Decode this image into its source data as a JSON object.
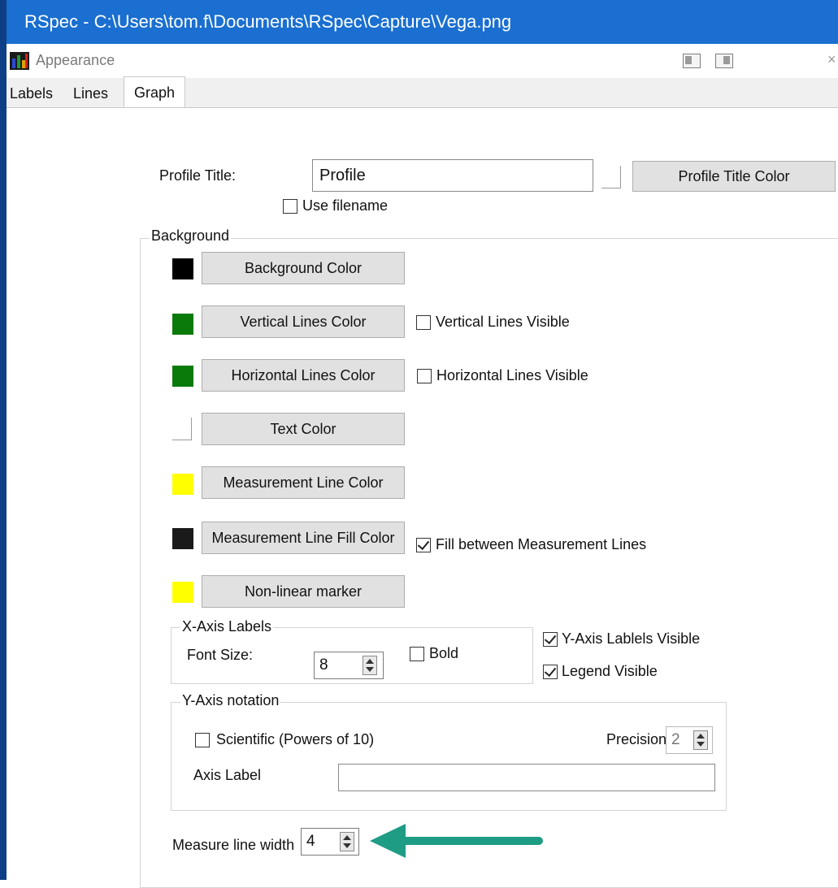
{
  "window": {
    "title": "RSpec - C:\\Users\\tom.f\\Documents\\RSpec\\Capture\\Vega.png"
  },
  "panel": {
    "title": "Appearance",
    "icons": [
      "app-logo-icon",
      "dock-left-icon",
      "dock-right-icon",
      "close-icon"
    ],
    "close_glyph": "×"
  },
  "tabs": [
    "Labels",
    "Lines",
    "Graph"
  ],
  "active_tab": "Graph",
  "profile": {
    "label": "Profile Title:",
    "value": "Profile",
    "use_filename_label": "Use filename",
    "use_filename_checked": false,
    "color_button": "Profile Title Color"
  },
  "background": {
    "legend": "Background",
    "rows": [
      {
        "swatch_color": "#000000",
        "button": "Background Color"
      },
      {
        "swatch_color": "#0a7a0a",
        "button": "Vertical Lines Color",
        "check_label": "Vertical Lines Visible",
        "checked": false
      },
      {
        "swatch_color": "#0a7a0a",
        "button": "Horizontal Lines Color",
        "check_label": "Horizontal Lines Visible",
        "checked": false
      },
      {
        "swatch_color": "#ffffff",
        "button": "Text Color"
      },
      {
        "swatch_color": "#ffff00",
        "button": "Measurement Line Color"
      },
      {
        "swatch_color": "#1a1a1a",
        "button": "Measurement Line Fill Color",
        "check_label": "Fill between Measurement Lines",
        "checked": true
      },
      {
        "swatch_color": "#ffff00",
        "button": "Non-linear marker"
      }
    ]
  },
  "x_axis": {
    "legend": "X-Axis Labels",
    "font_size_label": "Font Size:",
    "font_size_value": "8",
    "bold_label": "Bold",
    "bold_checked": false
  },
  "y_axis_visible": {
    "label": "Y-Axis Lablels Visible",
    "checked": true
  },
  "legend_visible": {
    "label": "Legend Visible",
    "checked": true
  },
  "y_axis": {
    "legend": "Y-Axis notation",
    "scientific_label": "Scientific (Powers of 10)",
    "scientific_checked": false,
    "precision_label": "Precision:",
    "precision_value": "2",
    "axis_label_label": "Axis Label",
    "axis_label_value": ""
  },
  "measure_line": {
    "label": "Measure line width",
    "value": "4"
  },
  "annotation": {
    "arrow_color": "#1e9c84"
  }
}
